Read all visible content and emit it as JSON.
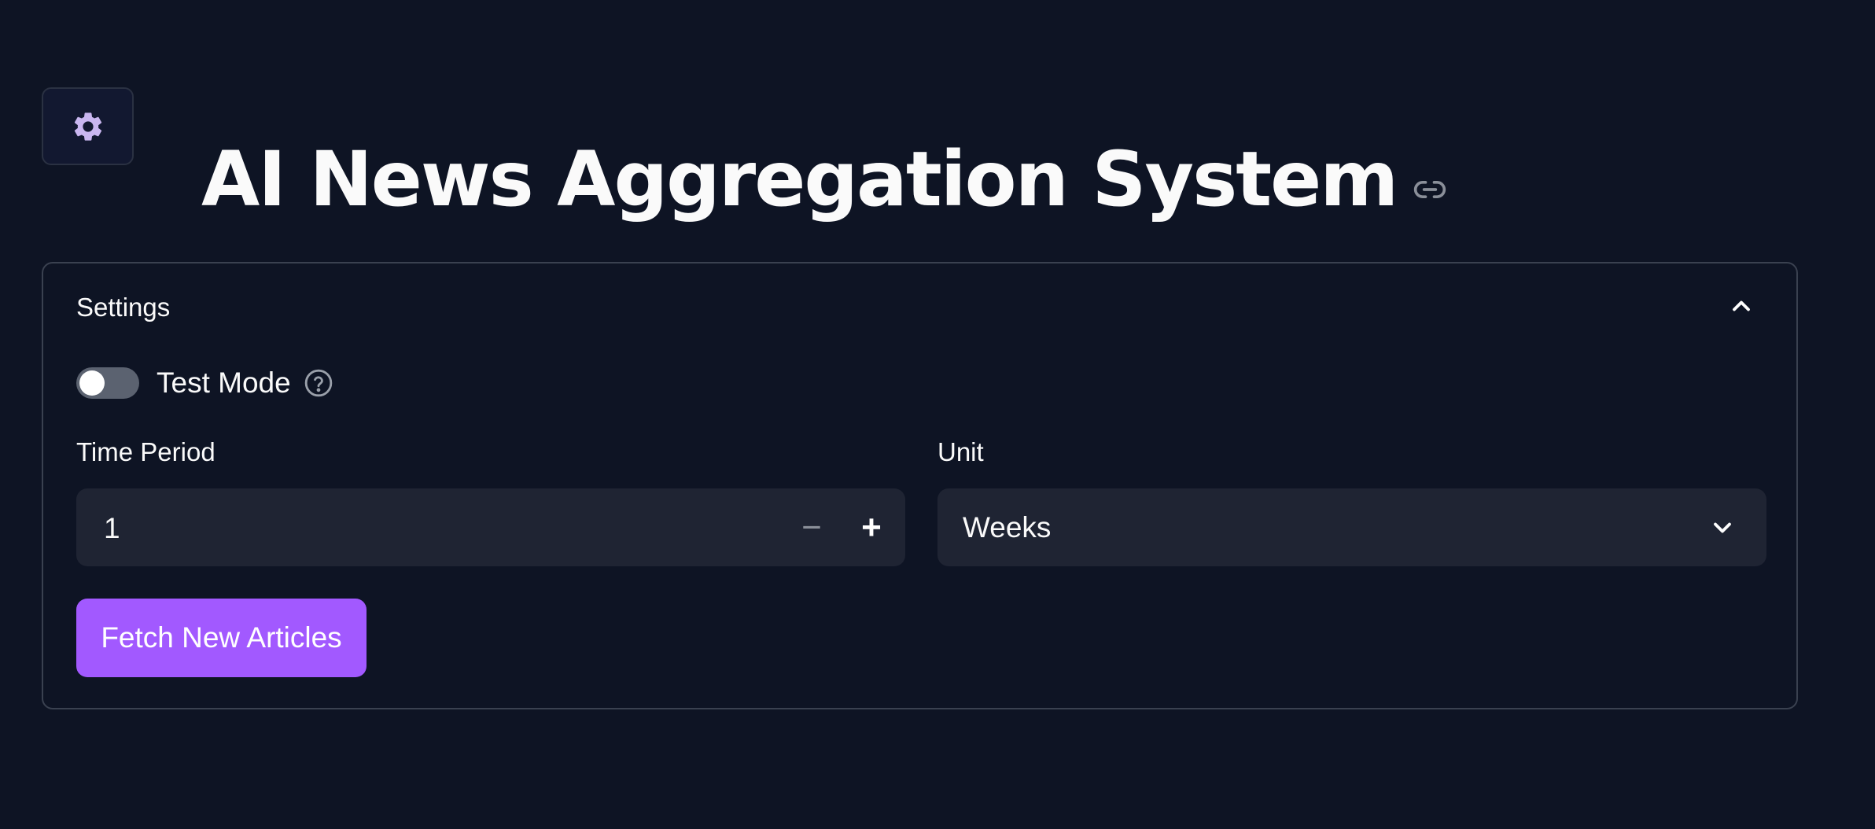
{
  "app": {
    "title": "AI News Aggregation System"
  },
  "icons": {
    "settings": "gear-icon",
    "anchor": "link-icon",
    "help": "question-circle-icon",
    "collapse": "chevron-up-icon",
    "dropdown": "chevron-down-icon"
  },
  "settings_panel": {
    "label": "Settings",
    "test_mode": {
      "label": "Test Mode",
      "enabled": false
    },
    "time_period": {
      "label": "Time Period",
      "value": "1",
      "decrement": "−",
      "increment": "+"
    },
    "unit": {
      "label": "Unit",
      "selected": "Weeks"
    },
    "fetch_button": {
      "label": "Fetch New Articles"
    }
  },
  "colors": {
    "background": "#0e1424",
    "accent": "#a259ff",
    "input_bg": "#1f2433",
    "border": "#3a4150",
    "gear_icon": "#c9b6f0"
  }
}
